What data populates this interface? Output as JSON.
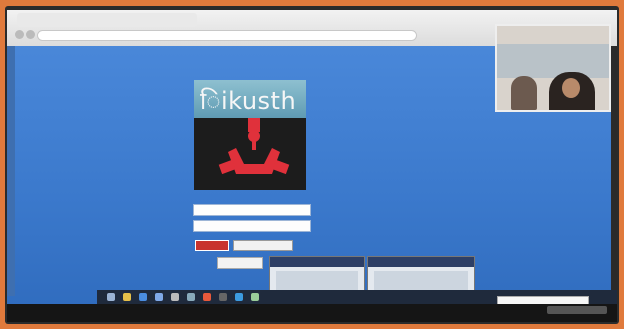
{
  "logo": {
    "text": "ikusth",
    "glyph": "ि"
  },
  "colors": {
    "desktop_background": "#3b79cc",
    "logo_top": "#6fa9bf",
    "logo_bottom": "#1c1c1c",
    "logo_symbol": "#e0313b",
    "login_button": "#c8342e",
    "taskbar": "#1f2a3c",
    "popup_title": "#2d3f66",
    "frame_border": "#e07a3c"
  },
  "icons": {
    "logo_symbol": "red-clamp-icon",
    "taskbar": [
      "search-icon",
      "file-explorer-icon",
      "browser-icon",
      "mail-icon",
      "store-icon",
      "app-icon",
      "chrome-icon",
      "terminal-icon",
      "video-icon",
      "settings-icon"
    ]
  }
}
